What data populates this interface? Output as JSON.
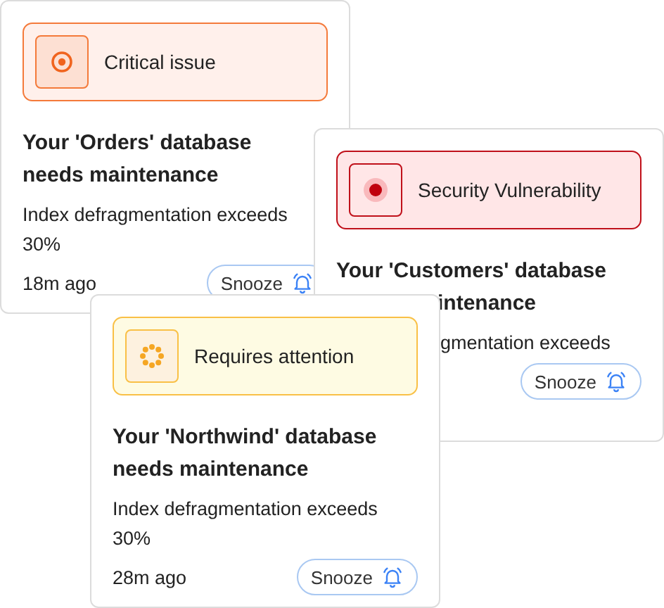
{
  "cards": [
    {
      "kind": "critical",
      "label": "Critical issue",
      "title_lines": [
        {
          "text": "Your 'Orders' database",
          "cut": false
        },
        {
          "text": "needs maintenance",
          "cut": false
        }
      ],
      "description_lines": [
        {
          "text": "Index defragmentation exceeds",
          "cut": false
        },
        {
          "text": "30%",
          "cut": false
        }
      ],
      "time": "18m ago",
      "button": "Snooze"
    },
    {
      "kind": "security",
      "label": "Security Vulnerability",
      "title_lines": [
        {
          "text": "Your 'Customers' database",
          "cut": false
        },
        {
          "text": "intenance",
          "cut": true
        }
      ],
      "description_lines": [
        {
          "text": "gmentation exceeds",
          "cut": true
        }
      ],
      "button": "Snooze"
    },
    {
      "kind": "warning",
      "label": "Requires attention",
      "title_lines": [
        {
          "text": "Your 'Northwind' database",
          "cut": false
        },
        {
          "text": "needs maintenance",
          "cut": false
        }
      ],
      "description_lines": [
        {
          "text": "Index defragmentation exceeds",
          "cut": false
        },
        {
          "text": "30%",
          "cut": false
        }
      ],
      "time": "28m ago",
      "button": "Snooze"
    }
  ]
}
